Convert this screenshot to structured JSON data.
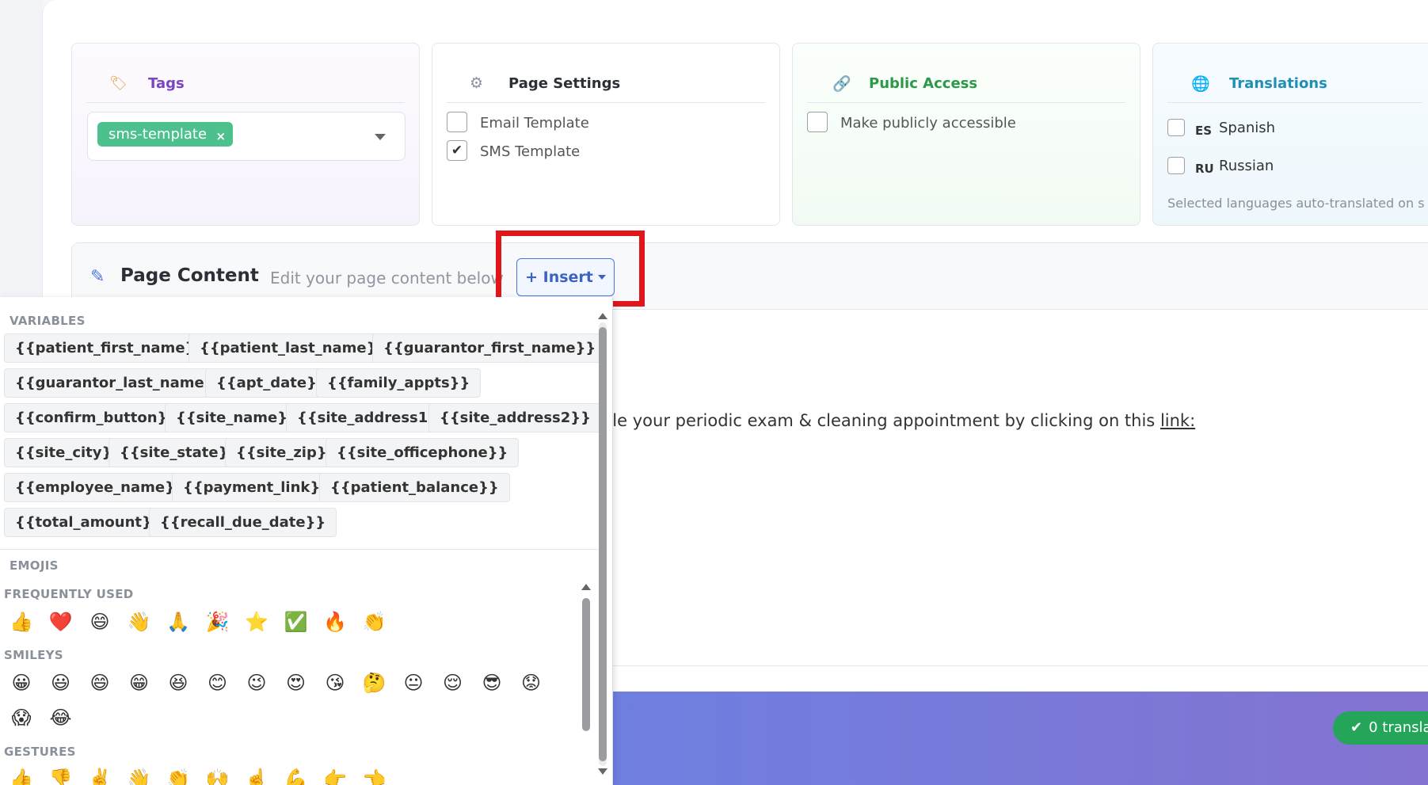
{
  "cards": {
    "tags": {
      "title": "Tags",
      "chip": "sms-template",
      "chip_remove": "×"
    },
    "page_settings": {
      "title": "Page Settings",
      "options": [
        {
          "label": "Email Template",
          "checked": false
        },
        {
          "label": "SMS Template",
          "checked": true
        }
      ]
    },
    "public_access": {
      "title": "Public Access",
      "option": "Make publicly accessible"
    },
    "translations": {
      "title": "Translations",
      "languages": [
        {
          "code": "ES",
          "label": "Spanish"
        },
        {
          "code": "RU",
          "label": "Russian"
        }
      ],
      "note": "Selected languages auto-translated on s"
    }
  },
  "content": {
    "title": "Page Content",
    "subtitle": "Edit your page content below",
    "insert_label": "+ Insert",
    "editor_text": "ule your periodic exam & cleaning appointment by clicking on this ",
    "editor_link": "link:"
  },
  "status": {
    "translations_pill": "0 transla"
  },
  "dropdown": {
    "variables_label": "VARIABLES",
    "variables": [
      "{{patient_first_name}}",
      "{{patient_last_name}}",
      "{{guarantor_first_name}}",
      "{{guarantor_last_name}}",
      "{{apt_date}}",
      "{{family_appts}}",
      "{{confirm_button}}",
      "{{site_name}}",
      "{{site_address1}}",
      "{{site_address2}}",
      "{{site_city}}",
      "{{site_state}}",
      "{{site_zip}}",
      "{{site_officephone}}",
      "{{employee_name}}",
      "{{payment_link}}",
      "{{patient_balance}}",
      "{{total_amount}}",
      "{{recall_due_date}}"
    ],
    "emojis_label": "EMOJIS",
    "frequent_label": "FREQUENTLY USED",
    "frequent": [
      "👍",
      "❤️",
      "😄",
      "👋",
      "🙏",
      "🎉",
      "⭐",
      "✅",
      "🔥",
      "👏"
    ],
    "smileys_label": "SMILEYS",
    "smileys": [
      "😀",
      "😃",
      "😄",
      "😁",
      "😆",
      "😊",
      "😉",
      "😍",
      "😘",
      "🤔",
      "😐",
      "😌",
      "😎",
      "😟",
      "😱",
      "😂"
    ],
    "gestures_label": "GESTURES",
    "gestures": [
      "👍",
      "👎",
      "✌️",
      "👋",
      "👏",
      "🙌",
      "☝️",
      "💪",
      "👉",
      "👈"
    ]
  }
}
